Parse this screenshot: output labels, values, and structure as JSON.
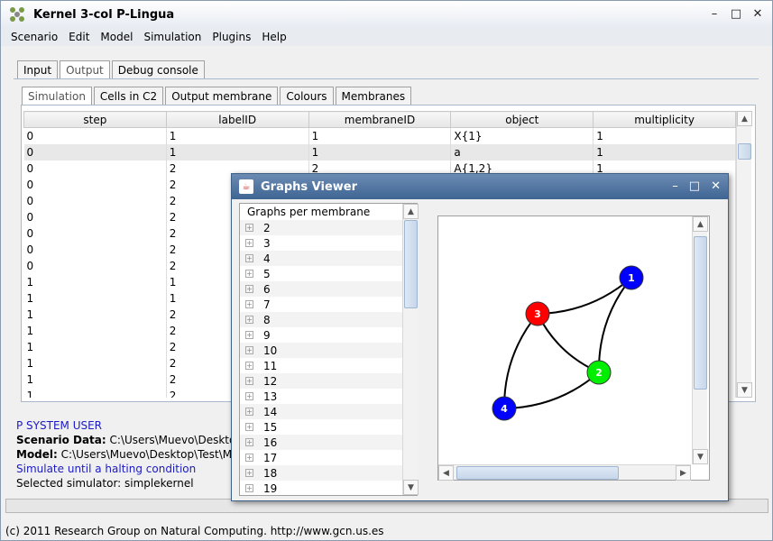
{
  "window": {
    "title": "Kernel 3-col P-Lingua"
  },
  "menu": [
    "Scenario",
    "Edit",
    "Model",
    "Simulation",
    "Plugins",
    "Help"
  ],
  "main_tabs": [
    {
      "label": "Input",
      "active": false
    },
    {
      "label": "Output",
      "active": true
    },
    {
      "label": "Debug console",
      "active": false
    }
  ],
  "sub_tabs": [
    {
      "label": "Simulation",
      "active": true
    },
    {
      "label": "Cells in C2",
      "active": false
    },
    {
      "label": "Output membrane",
      "active": false
    },
    {
      "label": "Colours",
      "active": false
    },
    {
      "label": "Membranes",
      "active": false
    }
  ],
  "table": {
    "columns": [
      "step",
      "labelID",
      "membraneID",
      "object",
      "multiplicity"
    ],
    "rows": [
      [
        "0",
        "1",
        "1",
        "X{1}",
        "1"
      ],
      [
        "0",
        "1",
        "1",
        "a",
        "1"
      ],
      [
        "0",
        "2",
        "2",
        "A{1,2}",
        "1"
      ],
      [
        "0",
        "2",
        "",
        "",
        ""
      ],
      [
        "0",
        "2",
        "",
        "",
        ""
      ],
      [
        "0",
        "2",
        "",
        "",
        ""
      ],
      [
        "0",
        "2",
        "",
        "",
        ""
      ],
      [
        "0",
        "2",
        "",
        "",
        ""
      ],
      [
        "0",
        "2",
        "",
        "",
        ""
      ],
      [
        "1",
        "1",
        "",
        "",
        ""
      ],
      [
        "1",
        "1",
        "",
        "",
        ""
      ],
      [
        "1",
        "2",
        "",
        "",
        ""
      ],
      [
        "1",
        "2",
        "",
        "",
        ""
      ],
      [
        "1",
        "2",
        "",
        "",
        ""
      ],
      [
        "1",
        "2",
        "",
        "",
        ""
      ],
      [
        "1",
        "2",
        "",
        "",
        ""
      ],
      [
        "1",
        "2",
        "",
        "",
        ""
      ]
    ]
  },
  "console": {
    "line1": "P SYSTEM USER",
    "scenario_label": "Scenario Data:",
    "scenario_value": "C:\\Users\\Muevo\\Desktop\\Test",
    "model_label": "Model:",
    "model_value": "C:\\Users\\Muevo\\Desktop\\Test\\MeCo",
    "line4": "Simulate until a halting condition",
    "line5": "Selected simulator: simplekernel"
  },
  "status": "(c) 2011 Research Group on Natural Computing. http://www.gcn.us.es",
  "dialog": {
    "title": "Graphs Viewer",
    "tree_header": "Graphs per membrane",
    "tree_items": [
      "2",
      "3",
      "4",
      "5",
      "6",
      "7",
      "8",
      "9",
      "10",
      "11",
      "12",
      "13",
      "14",
      "15",
      "16",
      "17",
      "18",
      "19"
    ]
  },
  "graph": {
    "nodes": [
      {
        "id": "1",
        "color": "#0000ff"
      },
      {
        "id": "2",
        "color": "#00ee00"
      },
      {
        "id": "3",
        "color": "#ff0000"
      },
      {
        "id": "4",
        "color": "#0000ff"
      }
    ],
    "edges": [
      [
        "3",
        "1"
      ],
      [
        "1",
        "2"
      ],
      [
        "3",
        "2"
      ],
      [
        "3",
        "4"
      ],
      [
        "4",
        "2"
      ]
    ]
  }
}
